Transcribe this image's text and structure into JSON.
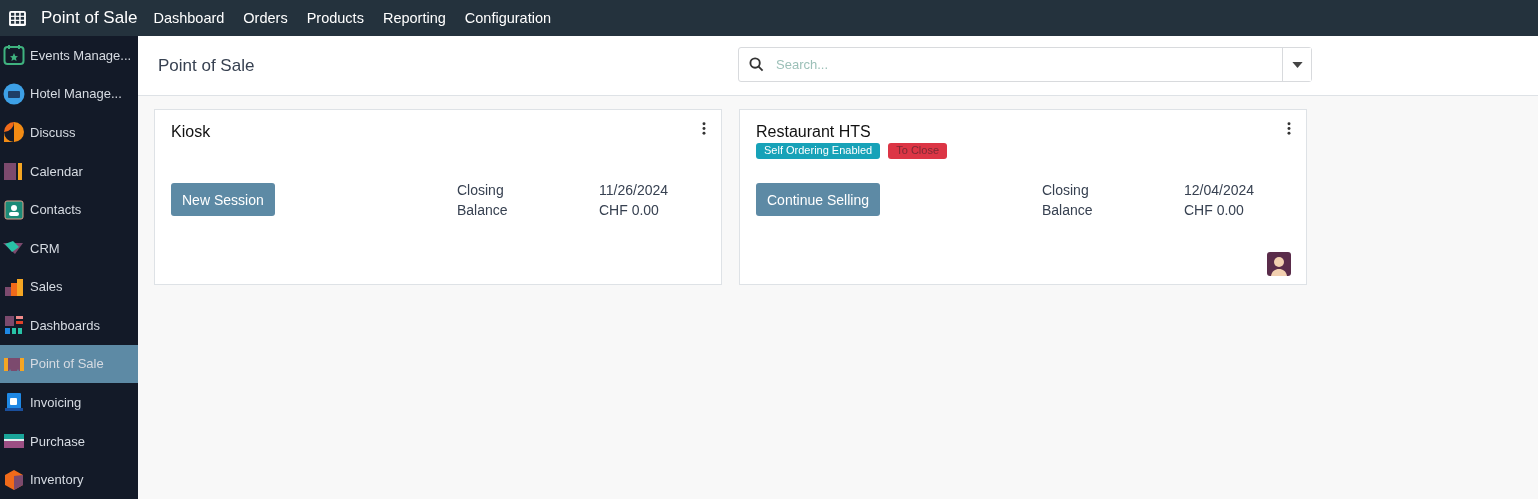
{
  "navbar": {
    "app_name": "Point of Sale",
    "menu": [
      "Dashboard",
      "Orders",
      "Products",
      "Reporting",
      "Configuration"
    ]
  },
  "sidebar": {
    "items": [
      {
        "label": "Events Manage...",
        "selected": false
      },
      {
        "label": "Hotel Manage...",
        "selected": false
      },
      {
        "label": "Discuss",
        "selected": false
      },
      {
        "label": "Calendar",
        "selected": false
      },
      {
        "label": "Contacts",
        "selected": false
      },
      {
        "label": "CRM",
        "selected": false
      },
      {
        "label": "Sales",
        "selected": false
      },
      {
        "label": "Dashboards",
        "selected": false
      },
      {
        "label": "Point of Sale",
        "selected": true
      },
      {
        "label": "Invoicing",
        "selected": false
      },
      {
        "label": "Purchase",
        "selected": false
      },
      {
        "label": "Inventory",
        "selected": false
      }
    ]
  },
  "control_panel": {
    "title": "Point of Sale",
    "search": {
      "placeholder": "Search..."
    }
  },
  "cards": [
    {
      "name": "Kiosk",
      "button": "New Session",
      "fields": [
        {
          "label": "Closing",
          "value": "11/26/2024"
        },
        {
          "label": "Balance",
          "value": "CHF 0.00"
        }
      ],
      "avatar": false
    },
    {
      "name": "Restaurant HTS",
      "tags": [
        {
          "label": "Self Ordering Enabled",
          "color": "#17a2b8"
        },
        {
          "label": "To Close",
          "color": "#dc3545"
        }
      ],
      "button": "Continue Selling",
      "fields": [
        {
          "label": "Closing",
          "value": "12/04/2024"
        },
        {
          "label": "Balance",
          "value": "CHF 0.00"
        }
      ],
      "avatar": true
    }
  ]
}
